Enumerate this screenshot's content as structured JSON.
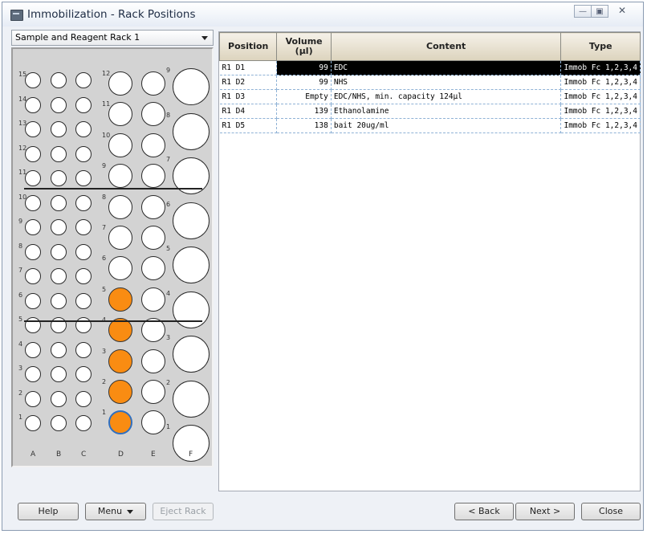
{
  "window": {
    "title": "Immobilization - Rack Positions"
  },
  "rack_selector": {
    "value": "Sample and Reagent Rack 1"
  },
  "rack": {
    "columns": [
      "A",
      "B",
      "C",
      "D",
      "E",
      "F"
    ],
    "row_numbers_small": [
      "15",
      "14",
      "13",
      "12",
      "11",
      "10",
      "9",
      "8",
      "7",
      "6",
      "5",
      "4",
      "3",
      "2",
      "1"
    ],
    "row_numbers_medium": [
      "12",
      "11",
      "10",
      "9",
      "8",
      "7",
      "6",
      "5",
      "4",
      "3",
      "2",
      "1"
    ],
    "row_numbers_large": [
      "9",
      "8",
      "7",
      "6",
      "5",
      "4",
      "3",
      "2",
      "1"
    ],
    "occupied_positions": [
      "D1",
      "D2",
      "D3",
      "D4",
      "D5"
    ],
    "selected_position": "D1"
  },
  "table": {
    "headers": {
      "position": "Position",
      "volume": "Volume\n(µl)",
      "content": "Content",
      "type": "Type"
    },
    "rows": [
      {
        "position": "R1 D1",
        "volume": "99",
        "content": "EDC",
        "type": "Immob Fc 1,2,3,4"
      },
      {
        "position": "R1 D2",
        "volume": "99",
        "content": "NHS",
        "type": "Immob Fc 1,2,3,4"
      },
      {
        "position": "R1 D3",
        "volume": "Empty",
        "content": "EDC/NHS, min. capacity 124µl",
        "type": "Immob Fc 1,2,3,4"
      },
      {
        "position": "R1 D4",
        "volume": "139",
        "content": "Ethanolamine",
        "type": "Immob Fc 1,2,3,4"
      },
      {
        "position": "R1 D5",
        "volume": "138",
        "content": "bait 20ug/ml",
        "type": "Immob Fc 1,2,3,4"
      }
    ],
    "selected_row": 0
  },
  "buttons": {
    "help": "Help",
    "menu": "Menu",
    "eject_rack": "Eject Rack",
    "back": "< Back",
    "next": "Next >",
    "close": "Close"
  },
  "colors": {
    "occupied": "#f98c12",
    "selection": "#000000"
  }
}
